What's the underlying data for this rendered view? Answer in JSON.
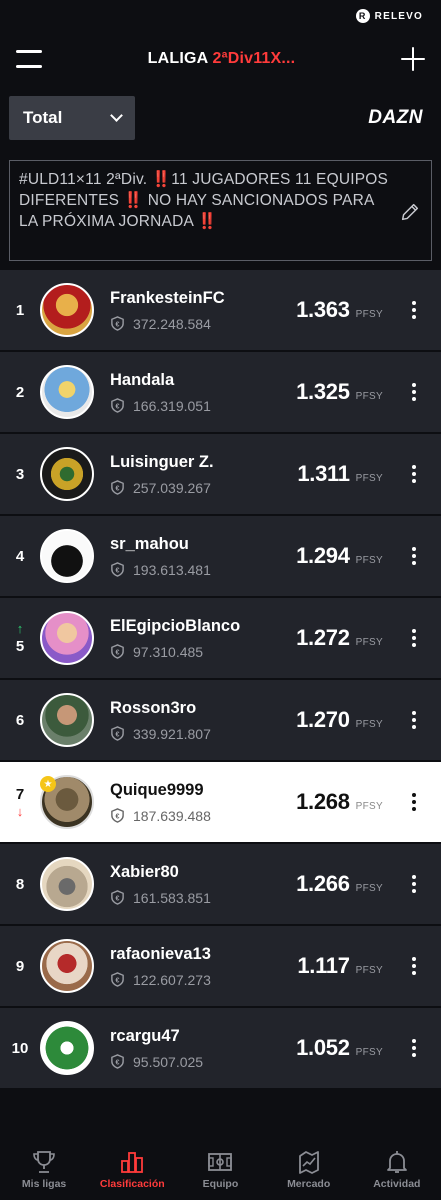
{
  "statusbar": {
    "brand": "RELEVO",
    "brand_logo_letter": "R"
  },
  "header": {
    "title_main": "LALIGA ",
    "title_accent": "2ªDiv11X...",
    "accent_color": "#ff3b3b"
  },
  "filter": {
    "selected": "Total",
    "partner": "DAZN"
  },
  "description": "#ULD11×11 2ªDiv. ‼️11 JUGADORES 11 EQUIPOS DIFERENTES ‼️ NO HAY SANCIONADOS PARA LA PRÓXIMA JORNADA ‼️",
  "ranking": [
    {
      "pos": "1",
      "trend": "",
      "name": "FrankesteinFC",
      "value": "372.248.584",
      "points": "1.363",
      "unit": "PFSY",
      "highlight": false,
      "avatar_icon": "player-photo-avatar"
    },
    {
      "pos": "2",
      "trend": "",
      "name": "Handala",
      "value": "166.319.051",
      "points": "1.325",
      "unit": "PFSY",
      "highlight": false,
      "avatar_icon": "cartoon-avatar"
    },
    {
      "pos": "3",
      "trend": "",
      "name": "Luisinguer Z.",
      "value": "257.039.267",
      "points": "1.311",
      "unit": "PFSY",
      "highlight": false,
      "avatar_icon": "monster-avatar"
    },
    {
      "pos": "4",
      "trend": "",
      "name": "sr_mahou",
      "value": "193.613.481",
      "points": "1.294",
      "unit": "PFSY",
      "highlight": false,
      "avatar_icon": "silhouette-avatar"
    },
    {
      "pos": "5",
      "trend": "up",
      "name": "ElEgipcioBlanco",
      "value": "97.310.485",
      "points": "1.272",
      "unit": "PFSY",
      "highlight": false,
      "avatar_icon": "person-photo-avatar"
    },
    {
      "pos": "6",
      "trend": "",
      "name": "Rosson3ro",
      "value": "339.921.807",
      "points": "1.270",
      "unit": "PFSY",
      "highlight": false,
      "avatar_icon": "person-photo-avatar"
    },
    {
      "pos": "7",
      "trend": "down",
      "name": "Quique9999",
      "value": "187.639.488",
      "points": "1.268",
      "unit": "PFSY",
      "highlight": true,
      "avatar_icon": "person-photo-avatar"
    },
    {
      "pos": "8",
      "trend": "",
      "name": "Xabier80",
      "value": "161.583.851",
      "points": "1.266",
      "unit": "PFSY",
      "highlight": false,
      "avatar_icon": "object-photo-avatar"
    },
    {
      "pos": "9",
      "trend": "",
      "name": "rafaonieva13",
      "value": "122.607.273",
      "points": "1.117",
      "unit": "PFSY",
      "highlight": false,
      "avatar_icon": "person-photo-avatar"
    },
    {
      "pos": "10",
      "trend": "",
      "name": "rcargu47",
      "value": "95.507.025",
      "points": "1.052",
      "unit": "PFSY",
      "highlight": false,
      "avatar_icon": "club-crest-avatar"
    }
  ],
  "nav": [
    {
      "label": "Mis ligas",
      "icon": "trophy-icon",
      "active": false
    },
    {
      "label": "Clasificación",
      "icon": "bar-chart-icon",
      "active": true
    },
    {
      "label": "Equipo",
      "icon": "pitch-icon",
      "active": false
    },
    {
      "label": "Mercado",
      "icon": "market-chart-icon",
      "active": false
    },
    {
      "label": "Actividad",
      "icon": "bell-icon",
      "active": false
    }
  ]
}
